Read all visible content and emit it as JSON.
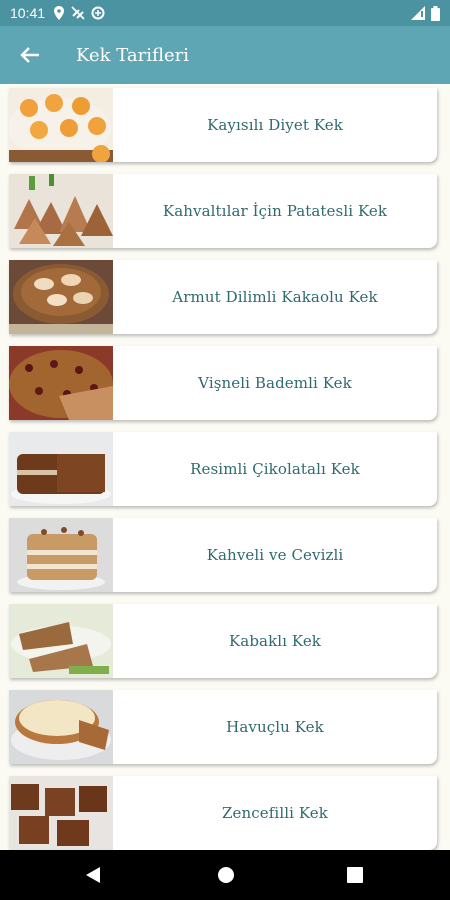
{
  "status_bar": {
    "time": "10:41",
    "left_icons": [
      "location-icon",
      "no-mobile-data-icon",
      "data-saver-icon"
    ],
    "right_icons": [
      "signal-icon",
      "battery-icon"
    ]
  },
  "app_bar": {
    "title": "Kek Tarifleri",
    "back_icon": "arrow-left-icon"
  },
  "recipes": [
    {
      "title": "Kayısılı Diyet Kek"
    },
    {
      "title": "Kahvaltılar İçin Patatesli Kek"
    },
    {
      "title": "Armut Dilimli Kakaolu Kek"
    },
    {
      "title": "Vişneli Bademli Kek"
    },
    {
      "title": "Resimli Çikolatalı Kek"
    },
    {
      "title": "Kahveli ve Cevizli"
    },
    {
      "title": "Kabaklı Kek"
    },
    {
      "title": "Havuçlu Kek"
    },
    {
      "title": "Zencefilli Kek"
    }
  ],
  "nav_bar": {
    "icons": [
      "back-triangle-icon",
      "home-circle-icon",
      "recents-square-icon"
    ]
  },
  "colors": {
    "status_bar": "#4c93a1",
    "app_bar": "#5fa6b4",
    "list_background": "#fbfaf3",
    "title_text": "#2f6a6f"
  }
}
